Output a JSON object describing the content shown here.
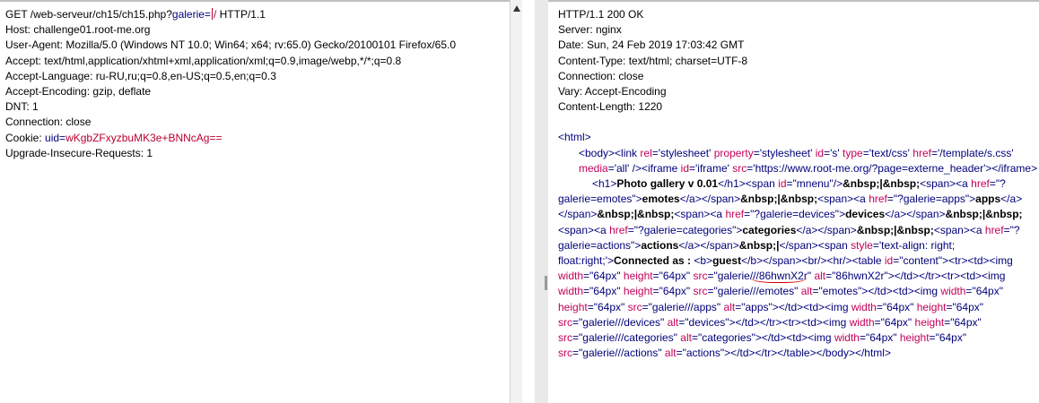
{
  "request": {
    "lines": [
      {
        "pre": "GET /web-serveur/ch15/ch15.php?",
        "pname": "galerie",
        "eq": "=",
        "pval": "/",
        "post": " HTTP/1.1"
      },
      {
        "text": "Host: challenge01.root-me.org"
      },
      {
        "text": "User-Agent: Mozilla/5.0 (Windows NT 10.0; Win64; x64; rv:65.0) Gecko/20100101 Firefox/65.0"
      },
      {
        "text": "Accept: text/html,application/xhtml+xml,application/xml;q=0.9,image/webp,*/*;q=0.8"
      },
      {
        "text": "Accept-Language: ru-RU,ru;q=0.8,en-US;q=0.5,en;q=0.3"
      },
      {
        "text": "Accept-Encoding: gzip, deflate"
      },
      {
        "text": "DNT: 1"
      },
      {
        "text": "Connection: close"
      },
      {
        "pre": "Cookie: ",
        "pname": "uid",
        "eq": "=",
        "pval": "wKgbZFxyzbuMK3e+BNNcAg=="
      },
      {
        "text": "Upgrade-Insecure-Requests: 1"
      }
    ]
  },
  "response": {
    "headers": [
      "HTTP/1.1 200 OK",
      "Server: nginx",
      "Date: Sun, 24 Feb 2019 17:03:42 GMT",
      "Content-Type: text/html; charset=UTF-8",
      "Connection: close",
      "Vary: Accept-Encoding",
      "Content-Length: 1220"
    ],
    "html_open": "<html>",
    "body_segments": [
      {
        "c": "tag",
        "t": "<body>"
      },
      {
        "c": "tag",
        "t": "<link "
      },
      {
        "c": "an",
        "t": "rel"
      },
      {
        "c": "tag",
        "t": "="
      },
      {
        "c": "av",
        "t": "'stylesheet' "
      },
      {
        "c": "an",
        "t": "property"
      },
      {
        "c": "tag",
        "t": "="
      },
      {
        "c": "av",
        "t": "'stylesheet' "
      },
      {
        "c": "an",
        "t": "id"
      },
      {
        "c": "tag",
        "t": "="
      },
      {
        "c": "av",
        "t": "'s' "
      },
      {
        "c": "an",
        "t": "type"
      },
      {
        "c": "tag",
        "t": "="
      },
      {
        "c": "av",
        "t": "'text/css' "
      },
      {
        "c": "an",
        "t": "href"
      },
      {
        "c": "tag",
        "t": "="
      },
      {
        "c": "av",
        "t": "'/template/s.css' "
      },
      {
        "c": "an",
        "t": "media"
      },
      {
        "c": "tag",
        "t": "="
      },
      {
        "c": "av",
        "t": "'all' "
      },
      {
        "c": "tag",
        "t": "/><iframe "
      },
      {
        "c": "an",
        "t": "id"
      },
      {
        "c": "tag",
        "t": "="
      },
      {
        "c": "av",
        "t": "'iframe' "
      },
      {
        "c": "an",
        "t": "src"
      },
      {
        "c": "tag",
        "t": "="
      },
      {
        "c": "av",
        "t": "'https://www.root-me.org/?page=externe_header'"
      },
      {
        "c": "tag",
        "t": "></iframe>"
      }
    ],
    "h1_segments": [
      {
        "c": "tag",
        "t": "<h1>"
      },
      {
        "c": "bt",
        "t": "Photo gallery v 0.01"
      },
      {
        "c": "tag",
        "t": "</h1><span "
      },
      {
        "c": "an",
        "t": "id"
      },
      {
        "c": "tag",
        "t": "="
      },
      {
        "c": "av",
        "t": "\"mnenu\""
      },
      {
        "c": "tag",
        "t": "/>"
      },
      {
        "c": "bt",
        "t": "&nbsp;|&nbsp;"
      },
      {
        "c": "tag",
        "t": "<span><a "
      },
      {
        "c": "an",
        "t": "href"
      },
      {
        "c": "tag",
        "t": "="
      },
      {
        "c": "av",
        "t": "\"?galerie=emotes\""
      },
      {
        "c": "tag",
        "t": ">"
      },
      {
        "c": "bt",
        "t": "emotes"
      },
      {
        "c": "tag",
        "t": "</a></span>"
      },
      {
        "c": "bt",
        "t": "&nbsp;|&nbsp;"
      },
      {
        "c": "tag",
        "t": "<span><a "
      },
      {
        "c": "an",
        "t": "href"
      },
      {
        "c": "tag",
        "t": "="
      },
      {
        "c": "av",
        "t": "\"?galerie=apps\""
      },
      {
        "c": "tag",
        "t": ">"
      },
      {
        "c": "bt",
        "t": "apps"
      },
      {
        "c": "tag",
        "t": "</a></span>"
      },
      {
        "c": "bt",
        "t": "&nbsp;|&nbsp;"
      },
      {
        "c": "tag",
        "t": "<span><a "
      },
      {
        "c": "an",
        "t": "href"
      },
      {
        "c": "tag",
        "t": "="
      },
      {
        "c": "av",
        "t": "\"?galerie=devices\""
      },
      {
        "c": "tag",
        "t": ">"
      },
      {
        "c": "bt",
        "t": "devices"
      },
      {
        "c": "tag",
        "t": "</a></span>"
      },
      {
        "c": "bt",
        "t": "&nbsp;|&nbsp;"
      },
      {
        "c": "tag",
        "t": "<span><a "
      },
      {
        "c": "an",
        "t": "href"
      },
      {
        "c": "tag",
        "t": "="
      },
      {
        "c": "av",
        "t": "\"?galerie=categories\""
      },
      {
        "c": "tag",
        "t": ">"
      },
      {
        "c": "bt",
        "t": "categories"
      },
      {
        "c": "tag",
        "t": "</a></span>"
      },
      {
        "c": "bt",
        "t": "&nbsp;|&nbsp;"
      },
      {
        "c": "tag",
        "t": "<span><a "
      },
      {
        "c": "an",
        "t": "href"
      },
      {
        "c": "tag",
        "t": "="
      },
      {
        "c": "av",
        "t": "\"?galerie=actions\""
      },
      {
        "c": "tag",
        "t": ">"
      },
      {
        "c": "bt",
        "t": "actions"
      },
      {
        "c": "tag",
        "t": "</a></span>"
      },
      {
        "c": "bt",
        "t": "&nbsp;|"
      },
      {
        "c": "tag",
        "t": "</span><span "
      },
      {
        "c": "an",
        "t": "style"
      },
      {
        "c": "tag",
        "t": "="
      },
      {
        "c": "av",
        "t": "'text-align: right; float:right;'"
      },
      {
        "c": "tag",
        "t": ">"
      },
      {
        "c": "bt",
        "t": "Connected as : "
      },
      {
        "c": "tag",
        "t": "<b>"
      },
      {
        "c": "bt",
        "t": "guest"
      },
      {
        "c": "tag",
        "t": "</b></span><br/><hr/><table "
      },
      {
        "c": "an",
        "t": "id"
      },
      {
        "c": "tag",
        "t": "="
      },
      {
        "c": "av",
        "t": "\"content\""
      },
      {
        "c": "tag",
        "t": "><tr><td><img "
      },
      {
        "c": "an",
        "t": "width"
      },
      {
        "c": "tag",
        "t": "="
      },
      {
        "c": "av",
        "t": "\"64px\" "
      },
      {
        "c": "an",
        "t": "height"
      },
      {
        "c": "tag",
        "t": "="
      },
      {
        "c": "av",
        "t": "\"64px\" "
      },
      {
        "c": "an",
        "t": "src"
      },
      {
        "c": "tag",
        "t": "="
      },
      {
        "c": "av",
        "t": "\"galerie"
      },
      {
        "c": "avu",
        "t": "///86hwnX2r"
      },
      {
        "c": "av",
        "t": "\" "
      },
      {
        "c": "an",
        "t": "alt"
      },
      {
        "c": "tag",
        "t": "="
      },
      {
        "c": "av",
        "t": "\"86hwnX2r\""
      },
      {
        "c": "tag",
        "t": "></td></tr><tr><td><img "
      },
      {
        "c": "an",
        "t": "width"
      },
      {
        "c": "tag",
        "t": "="
      },
      {
        "c": "av",
        "t": "\"64px\" "
      },
      {
        "c": "an",
        "t": "height"
      },
      {
        "c": "tag",
        "t": "="
      },
      {
        "c": "av",
        "t": "\"64px\" "
      },
      {
        "c": "an",
        "t": "src"
      },
      {
        "c": "tag",
        "t": "="
      },
      {
        "c": "av",
        "t": "\"galerie///emotes\" "
      },
      {
        "c": "an",
        "t": "alt"
      },
      {
        "c": "tag",
        "t": "="
      },
      {
        "c": "av",
        "t": "\"emotes\""
      },
      {
        "c": "tag",
        "t": "></td><td><img "
      },
      {
        "c": "an",
        "t": "width"
      },
      {
        "c": "tag",
        "t": "="
      },
      {
        "c": "av",
        "t": "\"64px\" "
      },
      {
        "c": "an",
        "t": "height"
      },
      {
        "c": "tag",
        "t": "="
      },
      {
        "c": "av",
        "t": "\"64px\" "
      },
      {
        "c": "an",
        "t": "src"
      },
      {
        "c": "tag",
        "t": "="
      },
      {
        "c": "av",
        "t": "\"galerie///apps\" "
      },
      {
        "c": "an",
        "t": "alt"
      },
      {
        "c": "tag",
        "t": "="
      },
      {
        "c": "av",
        "t": "\"apps\""
      },
      {
        "c": "tag",
        "t": "></td><td><img "
      },
      {
        "c": "an",
        "t": "width"
      },
      {
        "c": "tag",
        "t": "="
      },
      {
        "c": "av",
        "t": "\"64px\" "
      },
      {
        "c": "an",
        "t": "height"
      },
      {
        "c": "tag",
        "t": "="
      },
      {
        "c": "av",
        "t": "\"64px\" "
      },
      {
        "c": "an",
        "t": "src"
      },
      {
        "c": "tag",
        "t": "="
      },
      {
        "c": "av",
        "t": "\"galerie///devices\" "
      },
      {
        "c": "an",
        "t": "alt"
      },
      {
        "c": "tag",
        "t": "="
      },
      {
        "c": "av",
        "t": "\"devices\""
      },
      {
        "c": "tag",
        "t": "></td></tr><tr><td><img "
      },
      {
        "c": "an",
        "t": "width"
      },
      {
        "c": "tag",
        "t": "="
      },
      {
        "c": "av",
        "t": "\"64px\" "
      },
      {
        "c": "an",
        "t": "height"
      },
      {
        "c": "tag",
        "t": "="
      },
      {
        "c": "av",
        "t": "\"64px\" "
      },
      {
        "c": "an",
        "t": "src"
      },
      {
        "c": "tag",
        "t": "="
      },
      {
        "c": "av",
        "t": "\"galerie///categories\" "
      },
      {
        "c": "an",
        "t": "alt"
      },
      {
        "c": "tag",
        "t": "="
      },
      {
        "c": "av",
        "t": "\"categories\""
      },
      {
        "c": "tag",
        "t": "></td><td><img "
      },
      {
        "c": "an",
        "t": "width"
      },
      {
        "c": "tag",
        "t": "="
      },
      {
        "c": "av",
        "t": "\"64px\" "
      },
      {
        "c": "an",
        "t": "height"
      },
      {
        "c": "tag",
        "t": "="
      },
      {
        "c": "av",
        "t": "\"64px\" "
      },
      {
        "c": "an",
        "t": "src"
      },
      {
        "c": "tag",
        "t": "="
      },
      {
        "c": "av",
        "t": "\"galerie///actions\" "
      },
      {
        "c": "an",
        "t": "alt"
      },
      {
        "c": "tag",
        "t": "="
      },
      {
        "c": "av",
        "t": "\"actions\""
      },
      {
        "c": "tag",
        "t": "></td></tr></table></body></html>"
      }
    ]
  },
  "colors": {
    "param_name": "#00007a",
    "param_value": "#b8002e",
    "attr_name": "#c2005a",
    "tag": "#00007a",
    "annotation": "#cc0000"
  }
}
